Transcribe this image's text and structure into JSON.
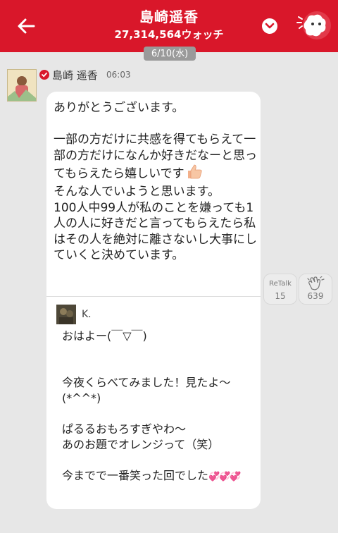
{
  "header": {
    "title": "島崎遥香",
    "watch_count": "27,314,564ウォッチ"
  },
  "date_separator": "6/10(水)",
  "post": {
    "author": "島崎 遥香",
    "time": "06:03",
    "message_before_thumb": "ありがとうございます。\n\n一部の方だけに共感を得てもらえて一部の方だけになんか好きだなーと思ってもらえたら嬉しいです",
    "message_after_thumb": "\nそんな人でいようと思います。\n100人中99人が私のことを嫌っても1人の人に好きだと言ってもらえたら私はその人を絶対に離さないし大事にしていくと決めています。",
    "quote": {
      "name": "K.",
      "text": "おはよー(￣▽￣)\n\n\n今夜くらべてみました！見たよ〜(*^^*)\n\nぱるるおもろすぎやわ〜\nあのお題でオレンジって（笑）\n\n今までで一番笑った回でした",
      "hearts": "💞💞💞"
    }
  },
  "actions": {
    "retalk": {
      "label": "ReTalk",
      "count": "15"
    },
    "clap": {
      "count": "639"
    }
  },
  "colors": {
    "header_bg": "#d9172a",
    "page_bg": "#e7e7e7",
    "accent": "#d9172a"
  }
}
